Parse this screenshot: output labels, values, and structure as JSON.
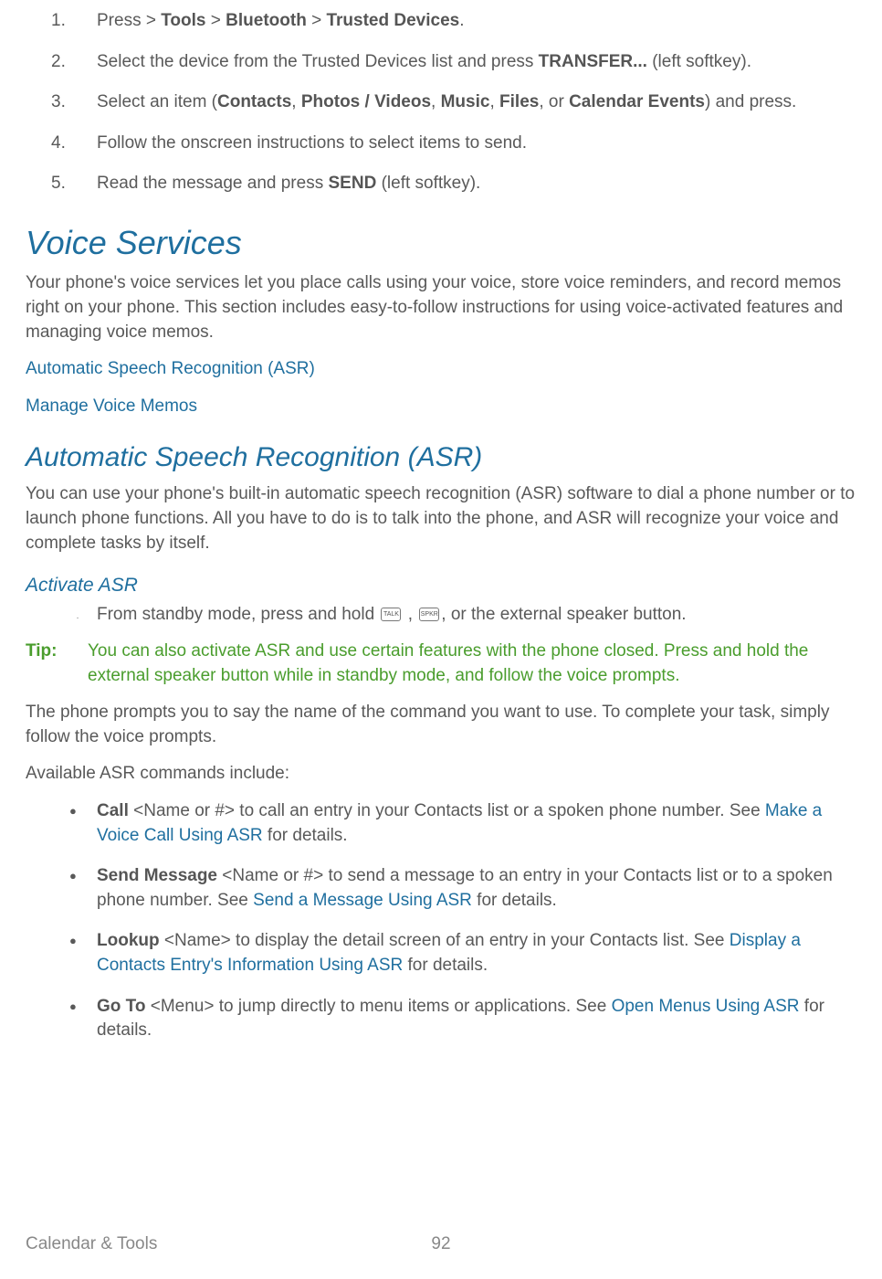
{
  "steps": [
    {
      "pre": "Press  > ",
      "bold_seq": [
        "Tools",
        "Bluetooth",
        "Trusted Devices"
      ],
      "post": "."
    },
    {
      "pre": "Select the device from the Trusted Devices list and press ",
      "bold": "TRANSFER...",
      "post": " (left softkey)."
    },
    {
      "pre": "Select an item (",
      "items": [
        "Contacts",
        "Photos / Videos",
        "Music",
        "Files",
        "Calendar Events"
      ],
      "post_items": ") and press."
    },
    {
      "plain": "Follow the onscreen instructions to select items to send."
    },
    {
      "pre": "Read the message and press ",
      "bold": "SEND",
      "post": " (left softkey)."
    }
  ],
  "h1_voice": "Voice Services",
  "voice_intro": "Your phone's voice services let you place calls using your voice, store voice reminders, and record memos right on your phone. This section includes easy-to-follow instructions for using voice-activated features and managing voice memos.",
  "toc": {
    "asr": "Automatic Speech Recognition (ASR)",
    "memos": "Manage Voice Memos"
  },
  "h2_asr": "Automatic Speech Recognition (ASR)",
  "asr_intro": "You can use your phone's built-in automatic speech recognition (ASR) software to dial a phone number or to launch phone functions. All you have to do is to talk into the phone, and ASR will recognize your voice and complete tasks by itself.",
  "h3_activate": "Activate ASR",
  "activate_line_pre": "From standby mode, press and hold ",
  "activate_line_post": ", or the external speaker button.",
  "key1": "TALK",
  "key2": "SPKR",
  "tip_label": "Tip:",
  "tip_body": "You can also activate ASR and use certain features with the phone closed. Press and hold the external speaker button while in standby mode, and follow the voice prompts.",
  "after_tip": "The phone prompts you to say the name of the command you want to use. To complete your task, simply follow the voice prompts.",
  "avail_hdr": "Available ASR commands include:",
  "cmds": [
    {
      "bold": "Call",
      "mid": " <Name or #> to call an entry in your Contacts list or a spoken phone number. See ",
      "link": "Make a Voice Call Using ASR",
      "post": " for details."
    },
    {
      "bold": "Send Message",
      "mid": " <Name or #> to send a message to an entry in your Contacts list or to a spoken phone number. See ",
      "link": "Send a Message Using ASR",
      "post": " for details."
    },
    {
      "bold": "Lookup",
      "mid": " <Name> to display the detail screen of an entry in your Contacts list. See ",
      "link": "Display a Contacts Entry's Information Using ASR",
      "post": " for details."
    },
    {
      "bold": "Go To",
      "mid": " <Menu> to jump directly to menu items or applications. See ",
      "link": "Open Menus Using ASR",
      "post": " for details."
    }
  ],
  "footer": {
    "section": "Calendar & Tools",
    "page": "92"
  }
}
